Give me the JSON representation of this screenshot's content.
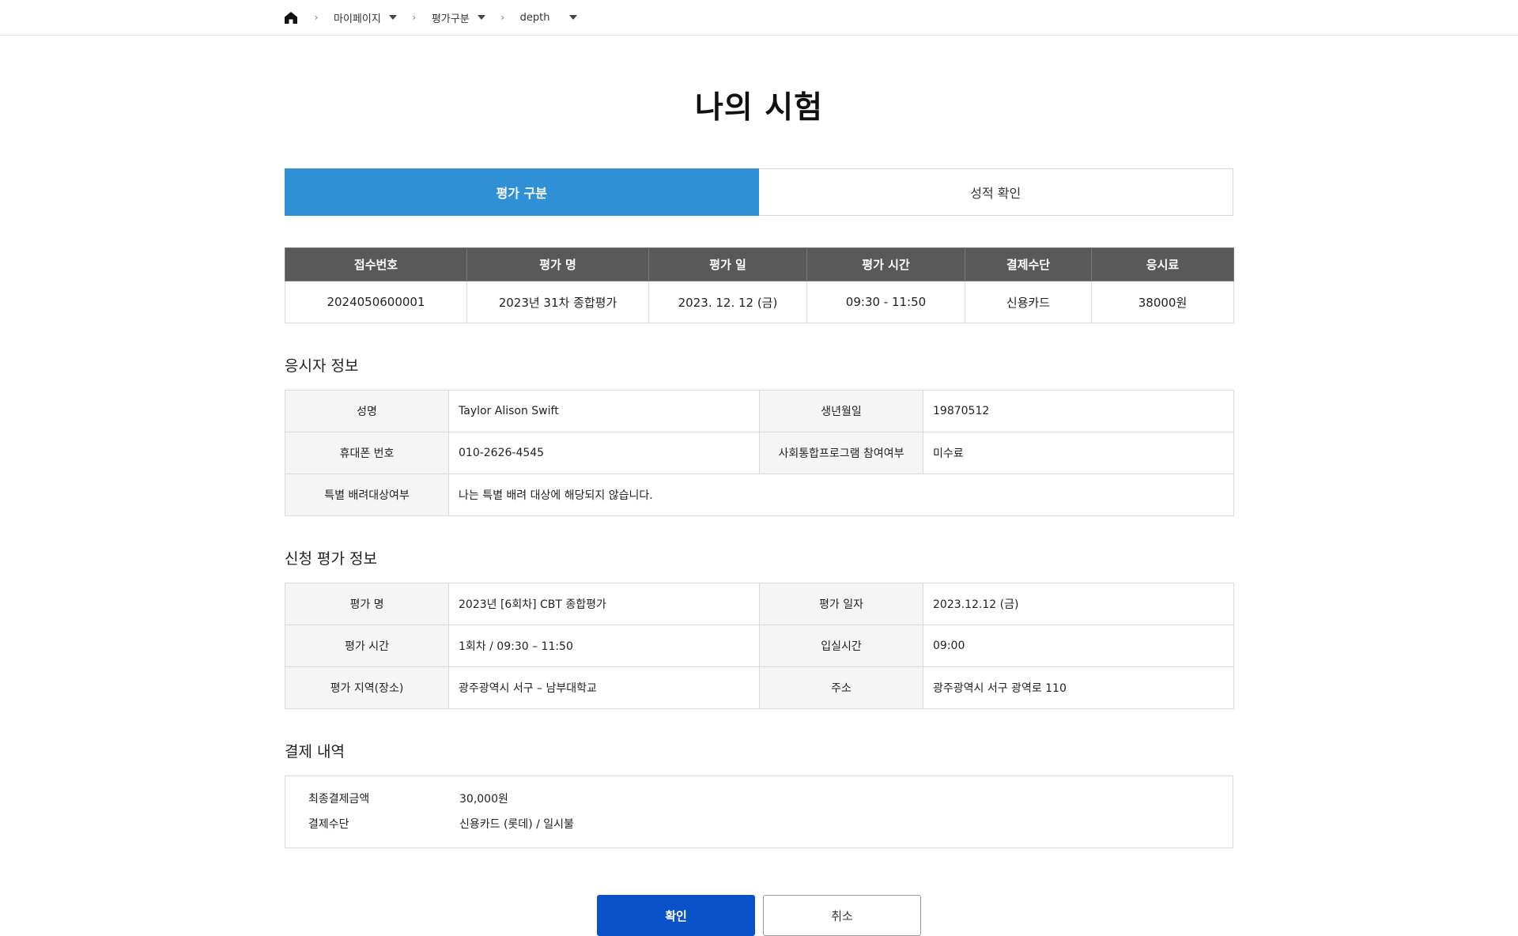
{
  "breadcrumb": {
    "items": [
      {
        "label": "마이페이지"
      },
      {
        "label": "평가구분"
      },
      {
        "label": "depth"
      }
    ]
  },
  "page": {
    "title": "나의 시험"
  },
  "tabs": [
    {
      "label": "평가 구분",
      "active": true
    },
    {
      "label": "성적 확인",
      "active": false
    }
  ],
  "summary": {
    "headers": [
      "접수번호",
      "평가 명",
      "평가 일",
      "평가 시간",
      "결제수단",
      "응시료"
    ],
    "row": [
      "2024050600001",
      "2023년 31차 종합평가",
      "2023. 12. 12 (금)",
      "09:30 - 11:50",
      "신용카드",
      "38000원"
    ]
  },
  "applicant": {
    "title": "응시자 정보",
    "name_label": "성명",
    "name": "Taylor Alison Swift",
    "birth_label": "생년월일",
    "birth": "19870512",
    "phone_label": "휴대폰 번호",
    "phone": "010-2626-4545",
    "program_label": "사회통합프로그램 참여여부",
    "program": "미수료",
    "special_label": "특별 배려대상여부",
    "special": "나는 특별 배려 대상에 해당되지 않습니다."
  },
  "exam": {
    "title": "신청 평가 정보",
    "name_label": "평가 명",
    "name": "2023년 [6회차] CBT 종합평가",
    "date_label": "평가 일자",
    "date": "2023.12.12 (금)",
    "time_label": "평가 시간",
    "time": "1회차 / 09:30 – 11:50",
    "entry_label": "입실시간",
    "entry": "09:00",
    "region_label": "평가 지역(장소)",
    "region": "광주광역시 서구 – 남부대학교",
    "address_label": "주소",
    "address": "광주광역시 서구 광역로 110"
  },
  "payment": {
    "title": "결제 내역",
    "amount_label": "최종결제금액",
    "amount": "30,000원",
    "method_label": "결제수단",
    "method": "신용카드 (롯데) / 일시불"
  },
  "buttons": {
    "confirm": "확인",
    "cancel": "취소"
  },
  "colors": {
    "tab_active": "#2f90d6",
    "header_bg": "#595959",
    "primary": "#0a52c9"
  }
}
